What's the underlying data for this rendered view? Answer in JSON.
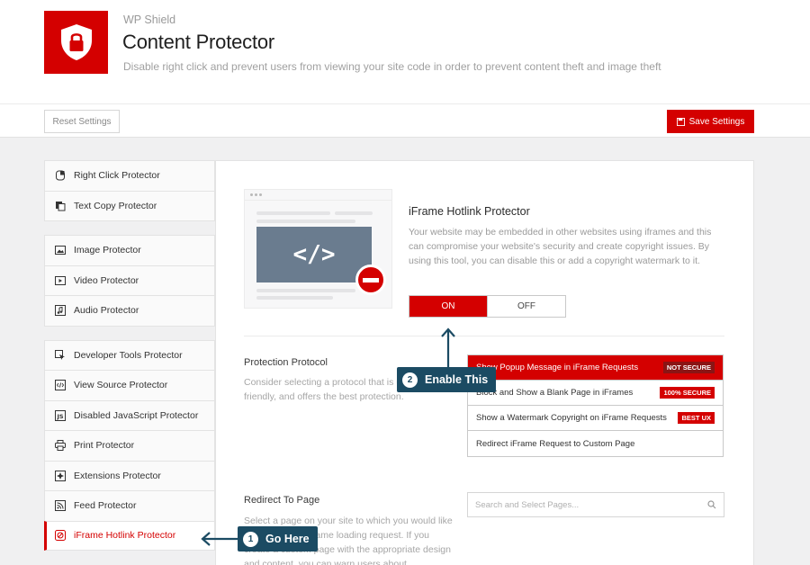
{
  "header": {
    "brand": "WP Shield",
    "title": "Content Protector",
    "description": "Disable right click and prevent users from viewing your site code in order to prevent content theft and image theft"
  },
  "toolbar": {
    "reset_label": "Reset Settings",
    "save_label": "Save Settings"
  },
  "sidebar": {
    "groups": [
      [
        {
          "label": "Right Click Protector",
          "icon": "mouse-icon"
        },
        {
          "label": "Text Copy Protector",
          "icon": "copy-icon"
        }
      ],
      [
        {
          "label": "Image Protector",
          "icon": "image-icon"
        },
        {
          "label": "Video Protector",
          "icon": "video-icon"
        },
        {
          "label": "Audio Protector",
          "icon": "music-icon"
        }
      ],
      [
        {
          "label": "Developer Tools Protector",
          "icon": "cursor-icon"
        },
        {
          "label": "View Source Protector",
          "icon": "code-icon"
        },
        {
          "label": "Disabled JavaScript Protector",
          "icon": "js-icon"
        },
        {
          "label": "Print Protector",
          "icon": "printer-icon"
        },
        {
          "label": "Extensions Protector",
          "icon": "puzzle-icon"
        },
        {
          "label": "Feed Protector",
          "icon": "rss-icon"
        },
        {
          "label": "iFrame Hotlink Protector",
          "icon": "block-icon",
          "active": true
        }
      ]
    ]
  },
  "main": {
    "title": "iFrame Hotlink Protector",
    "description": "Your website may be embedded in other websites using iframes and this can compromise your website's security and create copyright issues. By using this tool, you can disable this or add a copyright watermark to it.",
    "illustration_code": "</>",
    "toggle": {
      "on_label": "ON",
      "off_label": "OFF",
      "value": "ON"
    },
    "protection": {
      "title": "Protection Protocol",
      "description": "Consider selecting a protocol that is user-friendly, and offers the best protection.",
      "options": [
        {
          "label": "Show Popup Message in iFrame Requests",
          "badge": "NOT SECURE",
          "selected": true
        },
        {
          "label": "Block and Show a Blank Page in iFrames",
          "badge": "100% SECURE"
        },
        {
          "label": "Show a Watermark Copyright on iFrame Requests",
          "badge": "BEST UX"
        },
        {
          "label": "Redirect iFrame Request to Custom Page",
          "badge": ""
        }
      ]
    },
    "redirect": {
      "title": "Redirect To Page",
      "description": "Select a page on your site to which you would like to redirect the iFrame loading request. If you create a custom page with the appropriate design and content, you can warn users about",
      "search_placeholder": "Search and Select Pages..."
    }
  },
  "callouts": [
    {
      "num": "1",
      "label": "Go Here"
    },
    {
      "num": "2",
      "label": "Enable This"
    }
  ],
  "colors": {
    "accent": "#d40000",
    "callout": "#1b4b63"
  }
}
